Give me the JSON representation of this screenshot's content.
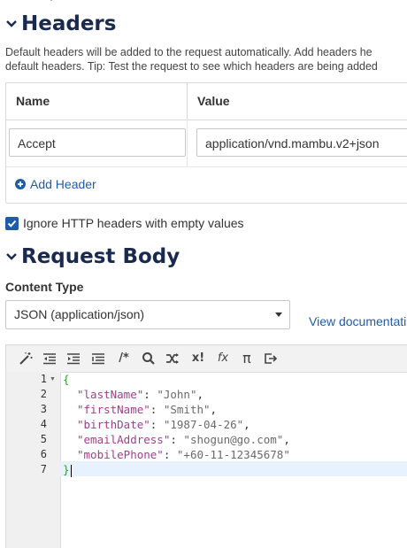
{
  "headers_section": {
    "title": "Headers",
    "description_line1": "Default headers will be added to the request automatically. Add headers he",
    "description_line2": "default headers. Tip: Test the request to see which headers are being added",
    "table": {
      "columns": [
        "Name",
        "Value"
      ],
      "rows": [
        {
          "name": "Accept",
          "value": "application/vnd.mambu.v2+json"
        }
      ]
    },
    "add_header_label": "Add Header",
    "ignore_empty_label": "Ignore HTTP headers with empty values",
    "ignore_empty_checked": true
  },
  "request_body": {
    "title": "Request Body",
    "content_type_label": "Content Type",
    "content_type_value": "JSON (application/json)",
    "view_docs_label": "View documentati",
    "editor": {
      "toolbar": [
        "magic-wand-icon",
        "outdent-icon",
        "indent-icon",
        "list-format-icon",
        "comment-icon",
        "search-icon",
        "shuffle-icon",
        "clear-format-icon",
        "function-icon",
        "pi-icon",
        "export-icon"
      ],
      "lines": [
        {
          "num": "1",
          "text": "{"
        },
        {
          "num": "2",
          "key": "\"lastName\"",
          "value": "\"John\""
        },
        {
          "num": "3",
          "key": "\"firstName\"",
          "value": "\"Smith\""
        },
        {
          "num": "4",
          "key": "\"birthDate\"",
          "value": "\"1987-04-26\""
        },
        {
          "num": "5",
          "key": "\"emailAddress\"",
          "value": "\"shogun@go.com\""
        },
        {
          "num": "6",
          "key": "\"mobilePhone\"",
          "value": "\"+60-11-12345678\""
        },
        {
          "num": "7",
          "text": "}"
        }
      ]
    }
  },
  "colors": {
    "title": "#1a2a4f",
    "link": "#1f5ca8",
    "json_key": "#a23e8c",
    "json_string": "#6a6a6a",
    "json_brace": "#2e9e2e"
  }
}
